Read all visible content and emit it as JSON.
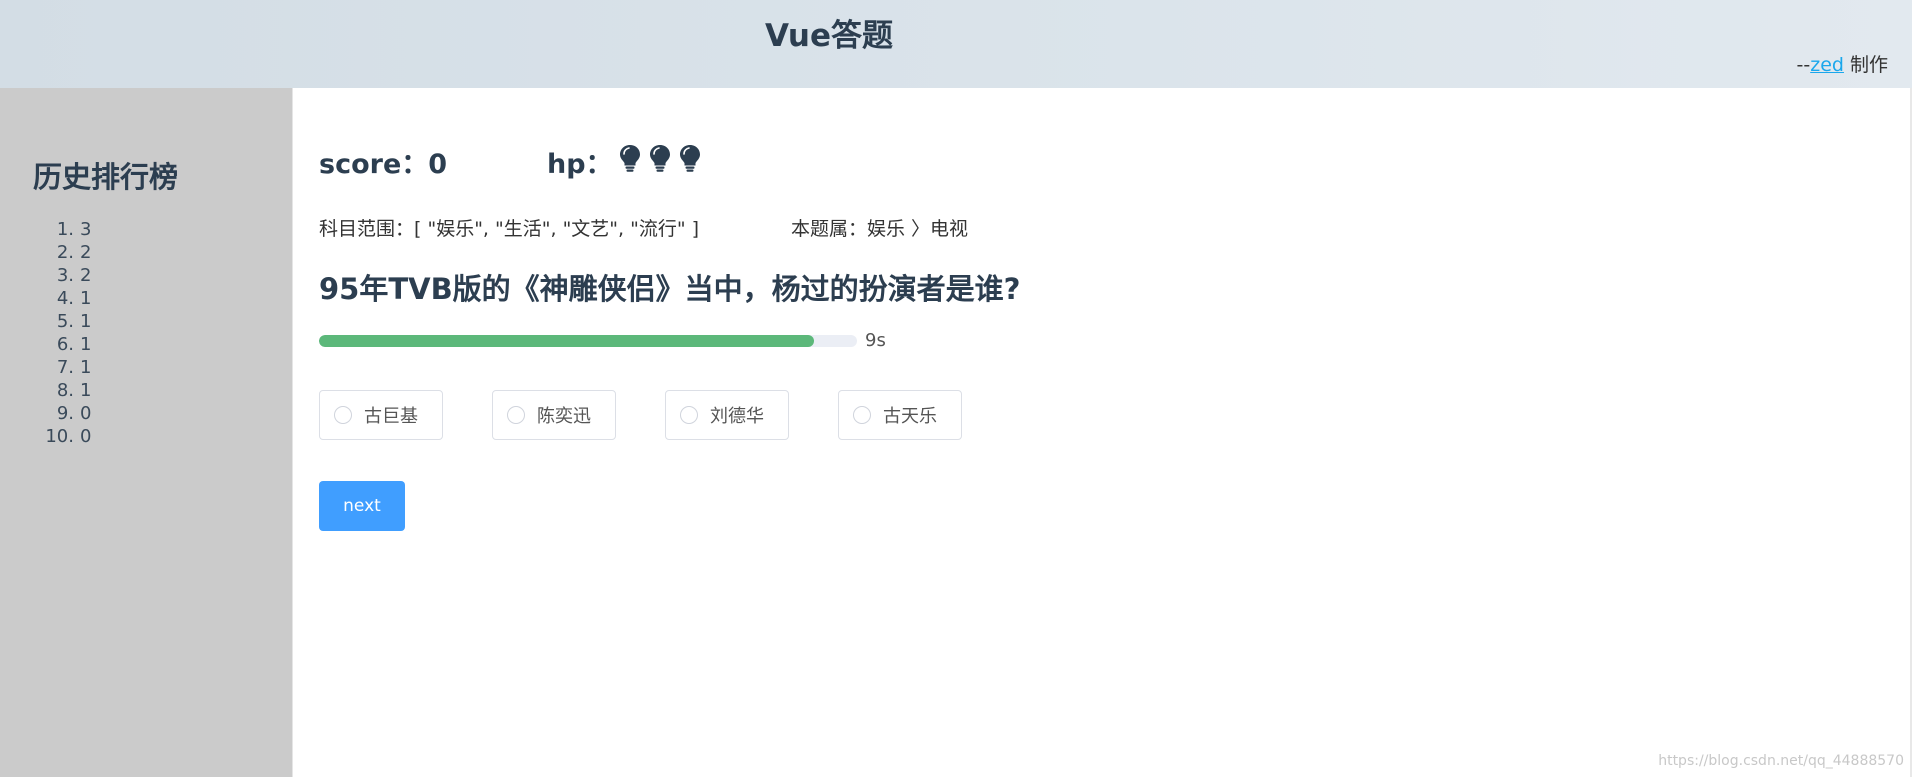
{
  "header": {
    "title": "Vue答题",
    "credit_prefix": "--",
    "credit_link": "zed",
    "credit_suffix": " 制作"
  },
  "sidebar": {
    "title": "历史排行榜",
    "ranks": [
      {
        "num": "1.",
        "score": "3"
      },
      {
        "num": "2.",
        "score": "2"
      },
      {
        "num": "3.",
        "score": "2"
      },
      {
        "num": "4.",
        "score": "1"
      },
      {
        "num": "5.",
        "score": "1"
      },
      {
        "num": "6.",
        "score": "1"
      },
      {
        "num": "7.",
        "score": "1"
      },
      {
        "num": "8.",
        "score": "1"
      },
      {
        "num": "9.",
        "score": "0"
      },
      {
        "num": "10.",
        "score": "0"
      }
    ]
  },
  "main": {
    "score_label": "score：0",
    "hp_label": "hp：",
    "hp_count": 3,
    "range_label": "科目范围：[ \"娱乐\", \"生活\", \"文艺\", \"流行\" ]",
    "category_label": "本题属：娱乐 〉电视",
    "question": "95年TVB版的《神雕侠侣》当中，杨过的扮演者是谁?",
    "progress_percent": 92,
    "progress_text": "9s",
    "options": [
      "古巨基",
      "陈奕迅",
      "刘德华",
      "古天乐"
    ],
    "next_label": "next"
  },
  "watermark": "https://blog.csdn.net/qq_44888570",
  "colors": {
    "accent": "#409eff",
    "progress": "#5cb87a",
    "sidebar_bg": "#cbcbcb",
    "link": "#1aa7ec"
  },
  "icons": {
    "hp": "lightbulb-icon"
  }
}
